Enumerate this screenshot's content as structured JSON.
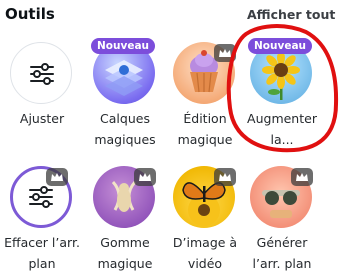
{
  "header": {
    "title": "Outils",
    "see_all": "Afficher tout"
  },
  "badge_new": "Nouveau",
  "tools": [
    {
      "label": "Ajuster"
    },
    {
      "label": "Calques\nmagiques"
    },
    {
      "label": "Édition\nmagique"
    },
    {
      "label": "Augmenter\nla..."
    },
    {
      "label": "Effacer l’arr.\nplan"
    },
    {
      "label": "Gomme\nmagique"
    },
    {
      "label": "D’image à\nvidéo"
    },
    {
      "label": "Générer\nl’arr. plan"
    }
  ],
  "colors": {
    "badge": "#7c4ddb",
    "annotation": "#e01010",
    "premium_badge": "#3c3c3c"
  },
  "icons": [
    "sliders-icon",
    "layers-image-icon",
    "cupcake-image-icon",
    "sunflower-image-icon",
    "crown-icon",
    "butterfly-image-icon",
    "sunglasses-image-icon",
    "eraser-image-icon"
  ]
}
